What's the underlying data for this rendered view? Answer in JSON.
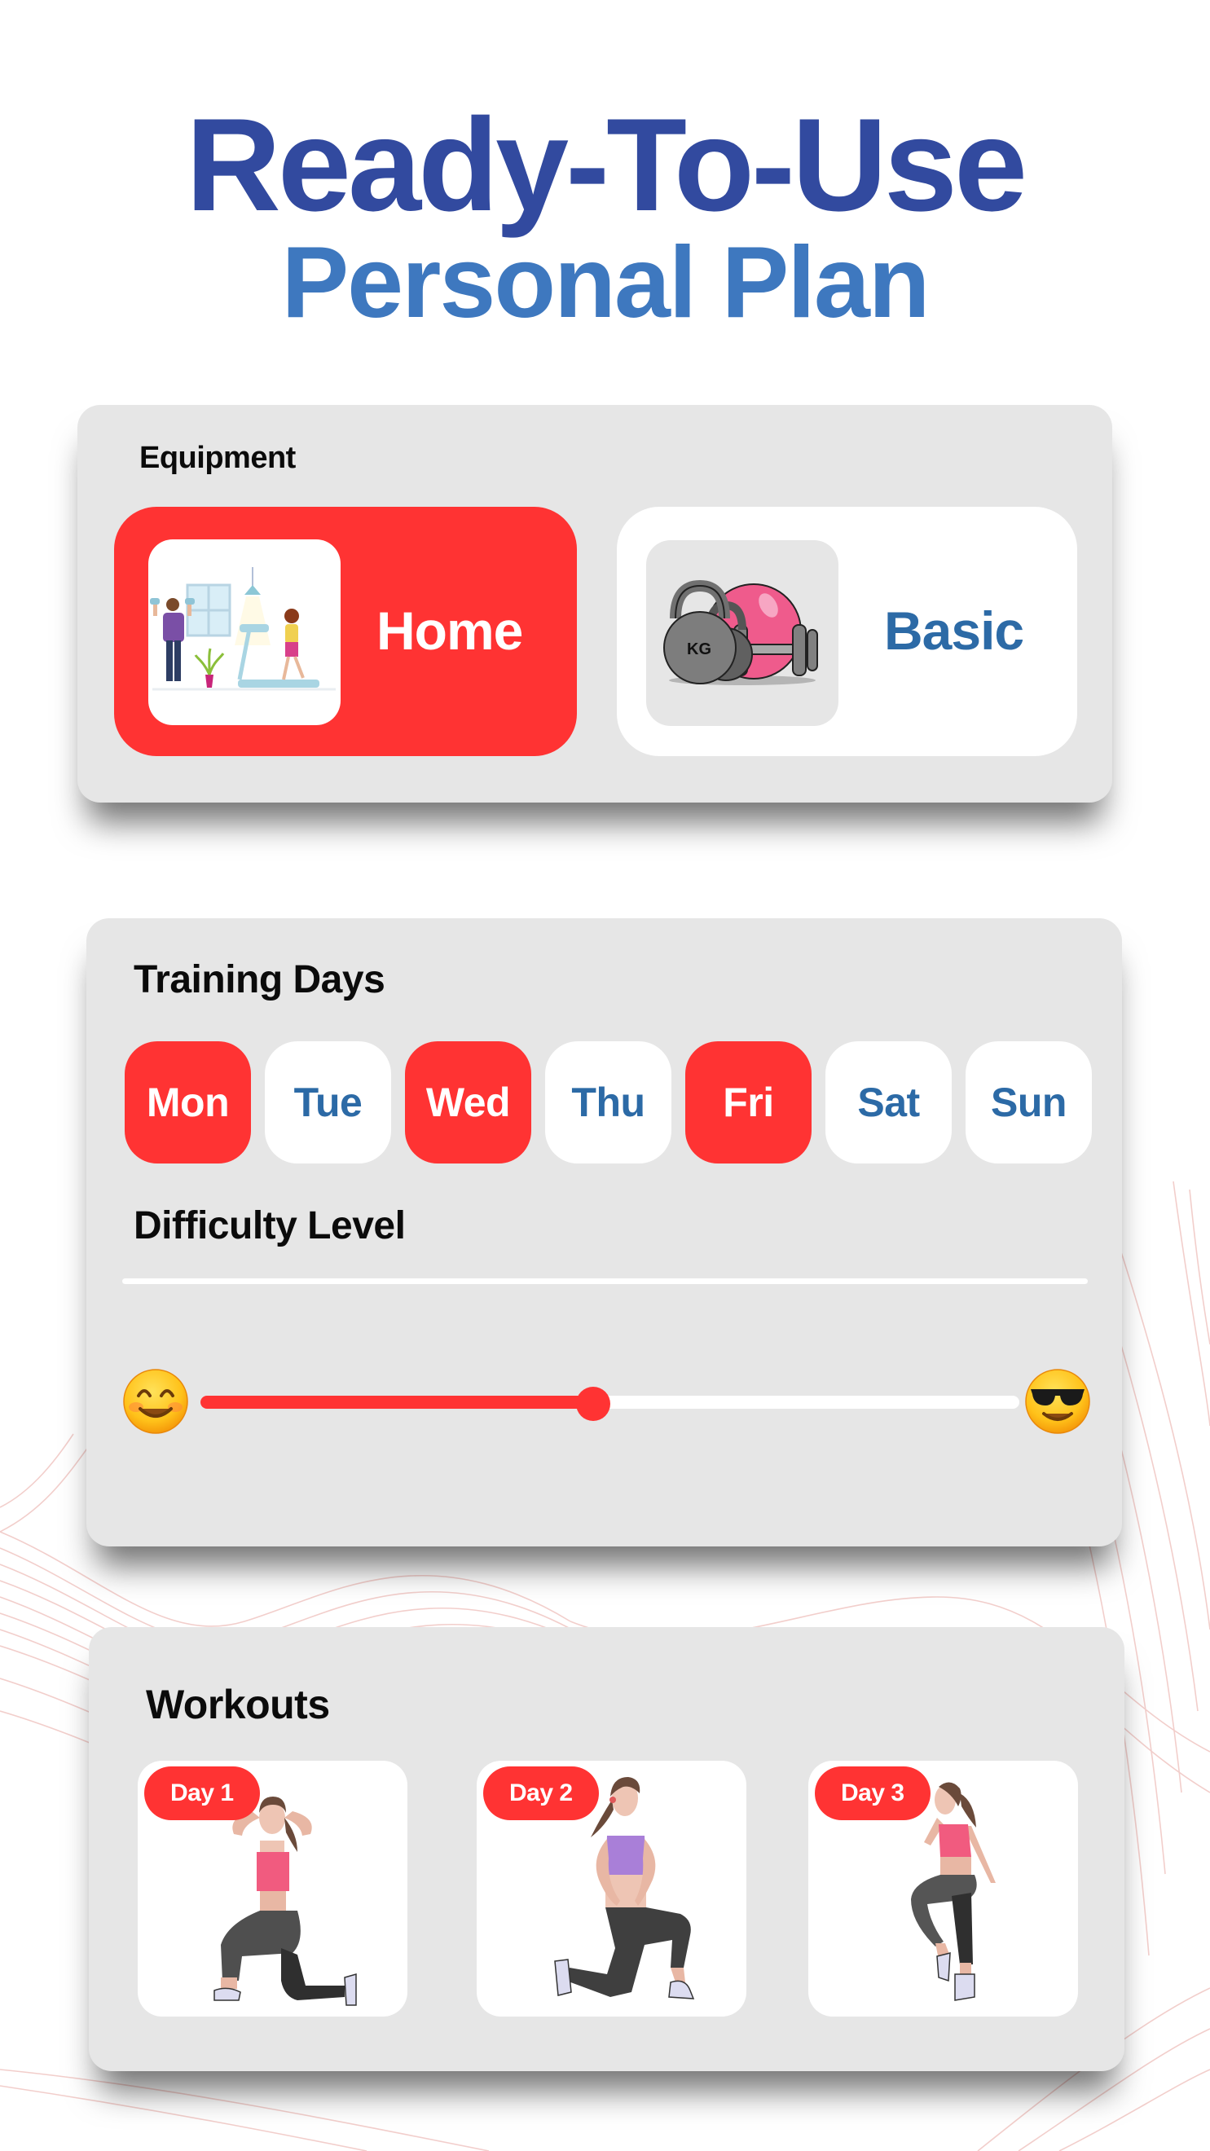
{
  "header": {
    "title_line1": "Ready-To-Use",
    "title_line2": "Personal Plan"
  },
  "colors": {
    "accent_red": "#ff3333",
    "title_blue_dark": "#324a9f",
    "title_blue_light": "#3e78bf",
    "label_blue": "#2c6aa6",
    "card_gray": "#e6e6e6"
  },
  "equipment": {
    "label": "Equipment",
    "options": [
      {
        "label": "Home",
        "image": "home-workout-illustration",
        "selected": true
      },
      {
        "label": "Basic",
        "image": "kettlebell-dumbbell-ball-illustration",
        "selected": false
      }
    ]
  },
  "training_days": {
    "label": "Training Days",
    "days": [
      {
        "label": "Mon",
        "selected": true
      },
      {
        "label": "Tue",
        "selected": false
      },
      {
        "label": "Wed",
        "selected": true
      },
      {
        "label": "Thu",
        "selected": false
      },
      {
        "label": "Fri",
        "selected": true
      },
      {
        "label": "Sat",
        "selected": false
      },
      {
        "label": "Sun",
        "selected": false
      }
    ]
  },
  "difficulty": {
    "label": "Difficulty Level",
    "min_icon": "smiling-face-emoji",
    "max_icon": "sunglasses-face-emoji",
    "value_fraction": 0.48
  },
  "workouts": {
    "label": "Workouts",
    "items": [
      {
        "badge": "Day 1",
        "image": "lunge-hands-behind-head"
      },
      {
        "badge": "Day 2",
        "image": "lunge-hands-on-hips"
      },
      {
        "badge": "Day 3",
        "image": "high-knee-raise"
      }
    ]
  }
}
